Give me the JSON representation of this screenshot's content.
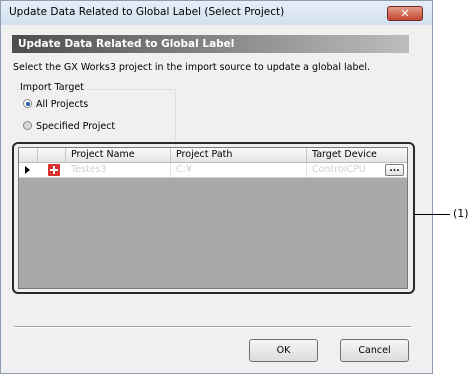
{
  "window": {
    "title": "Update Data Related to Global Label (Select Project)",
    "close_glyph": "✕"
  },
  "banner": {
    "title": "Update Data Related to Global Label"
  },
  "description": "Select the GX Works3 project in the import source to update a global label.",
  "import_target": {
    "label": "Import Target",
    "options": [
      {
        "label": "All Projects",
        "selected": true
      },
      {
        "label": "Specified Project",
        "selected": false
      }
    ]
  },
  "grid": {
    "columns": [
      "Project Name",
      "Project Path",
      "Target Device"
    ],
    "rows": [
      {
        "project_name": "Testes3",
        "project_path": "C:¥",
        "target_device": "ControlCPU",
        "browse_label": "..."
      }
    ]
  },
  "buttons": {
    "ok": "OK",
    "cancel": "Cancel"
  },
  "callout": {
    "label": "(1)"
  },
  "icons": {
    "row_pointer": "arrow-right-icon",
    "project": "project-file-icon",
    "close": "close-icon"
  }
}
